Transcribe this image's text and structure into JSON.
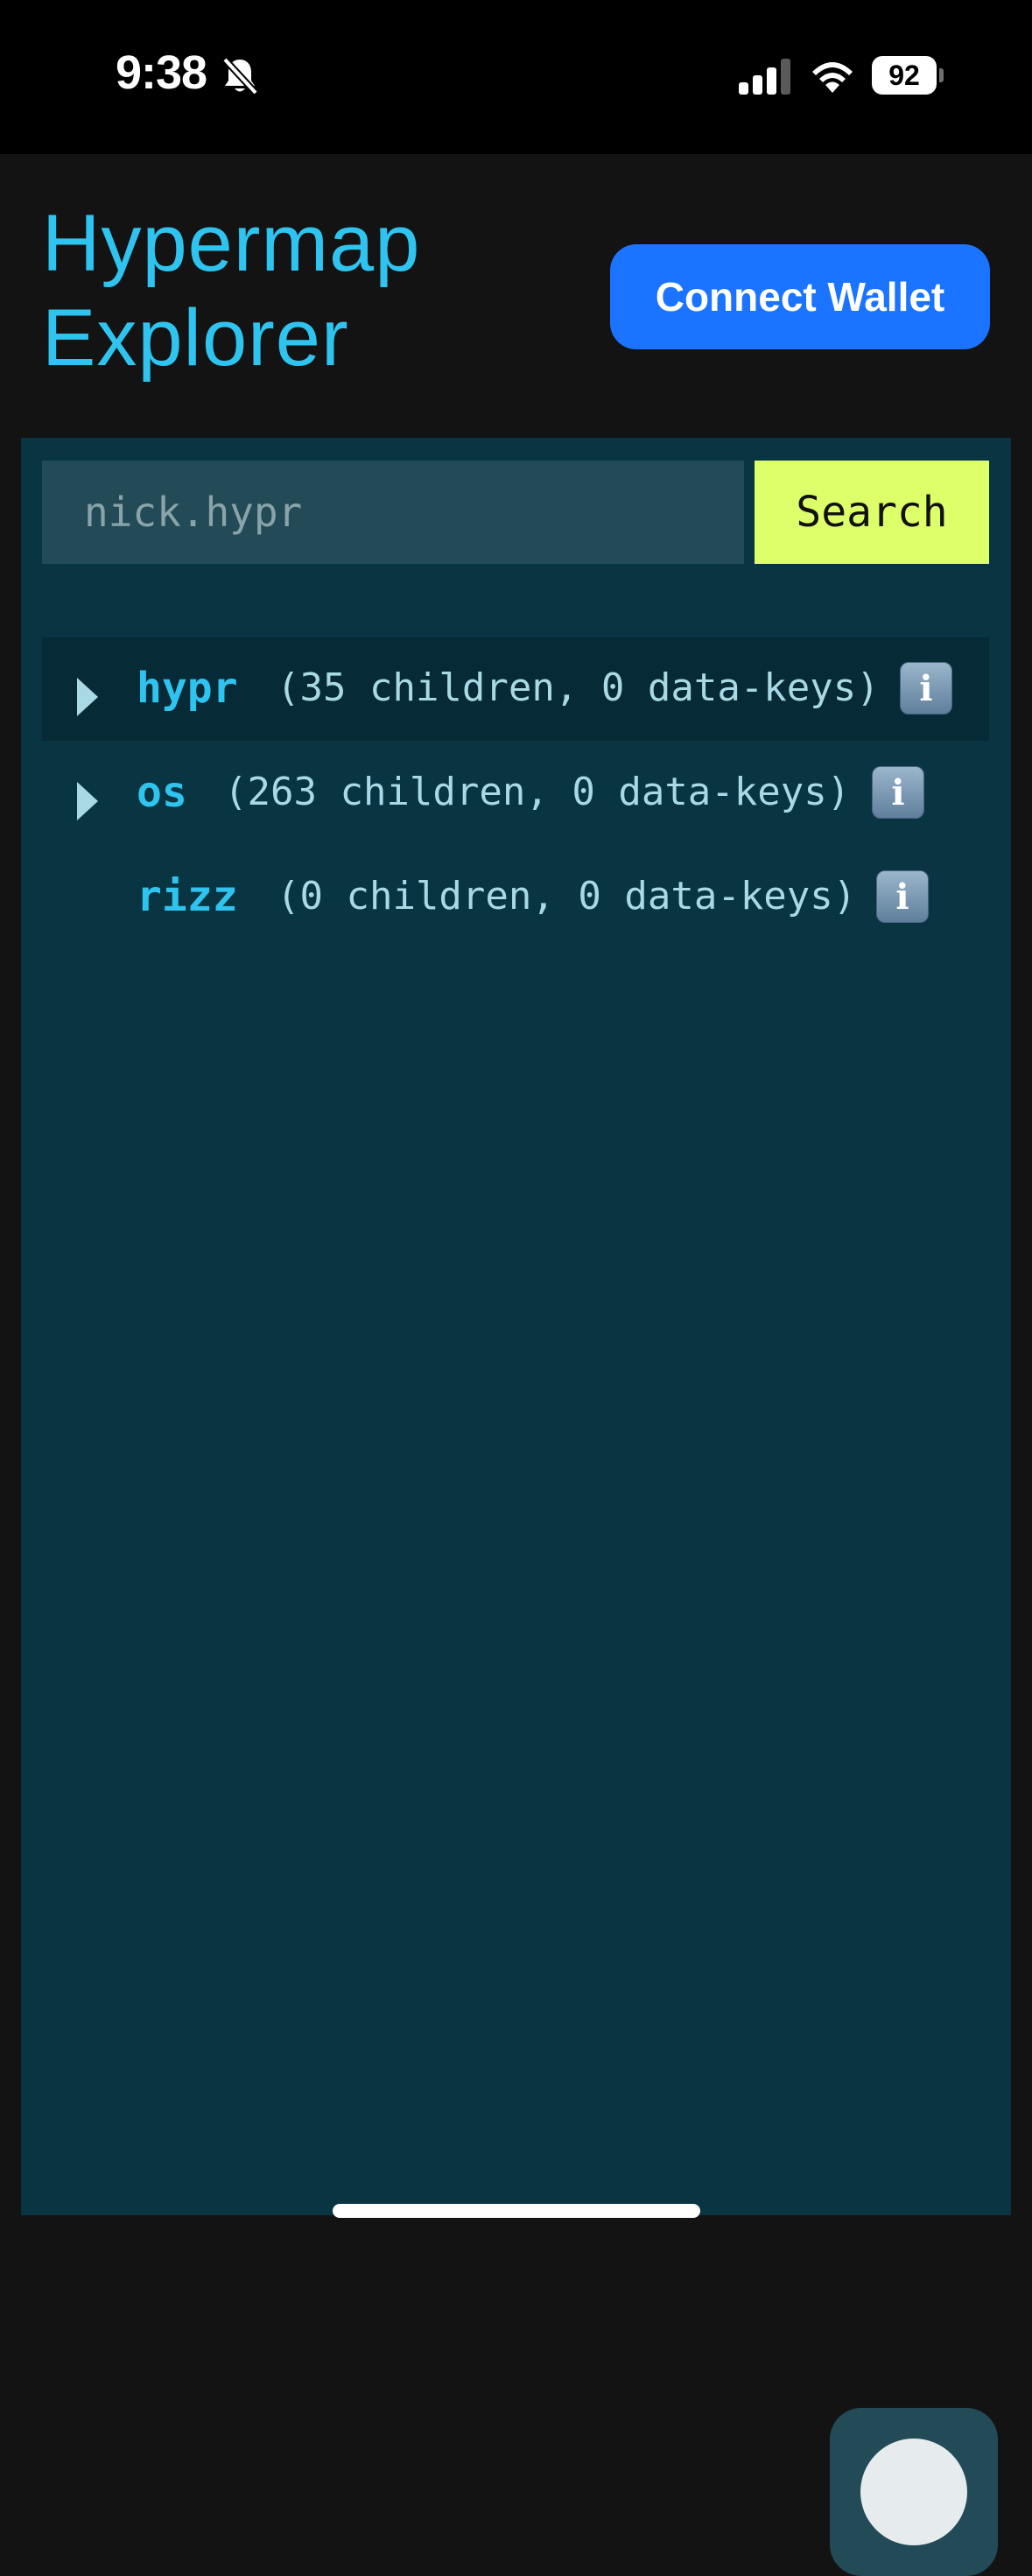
{
  "status_bar": {
    "time": "9:38",
    "battery_level": "92",
    "icons": [
      "bell-slash-icon",
      "cellular-signal-icon",
      "wifi-icon",
      "battery-icon"
    ]
  },
  "header": {
    "title": "Hypermap Explorer",
    "connect_wallet_label": "Connect Wallet"
  },
  "search": {
    "placeholder": "nick.hypr",
    "value": "",
    "button_label": "Search"
  },
  "tree": {
    "items": [
      {
        "name": "hypr",
        "meta": "(35 children, 0 data-keys)",
        "expandable": true,
        "highlighted": true
      },
      {
        "name": "os",
        "meta": "(263 children, 0 data-keys)",
        "expandable": true,
        "highlighted": false
      },
      {
        "name": "rizz",
        "meta": "(0 children, 0 data-keys)",
        "expandable": false,
        "highlighted": false
      }
    ]
  },
  "colors": {
    "accent": "#2fc4ef",
    "connect_button": "#1a74ff",
    "search_button": "#dcff6a",
    "panel_background": "#093442"
  }
}
